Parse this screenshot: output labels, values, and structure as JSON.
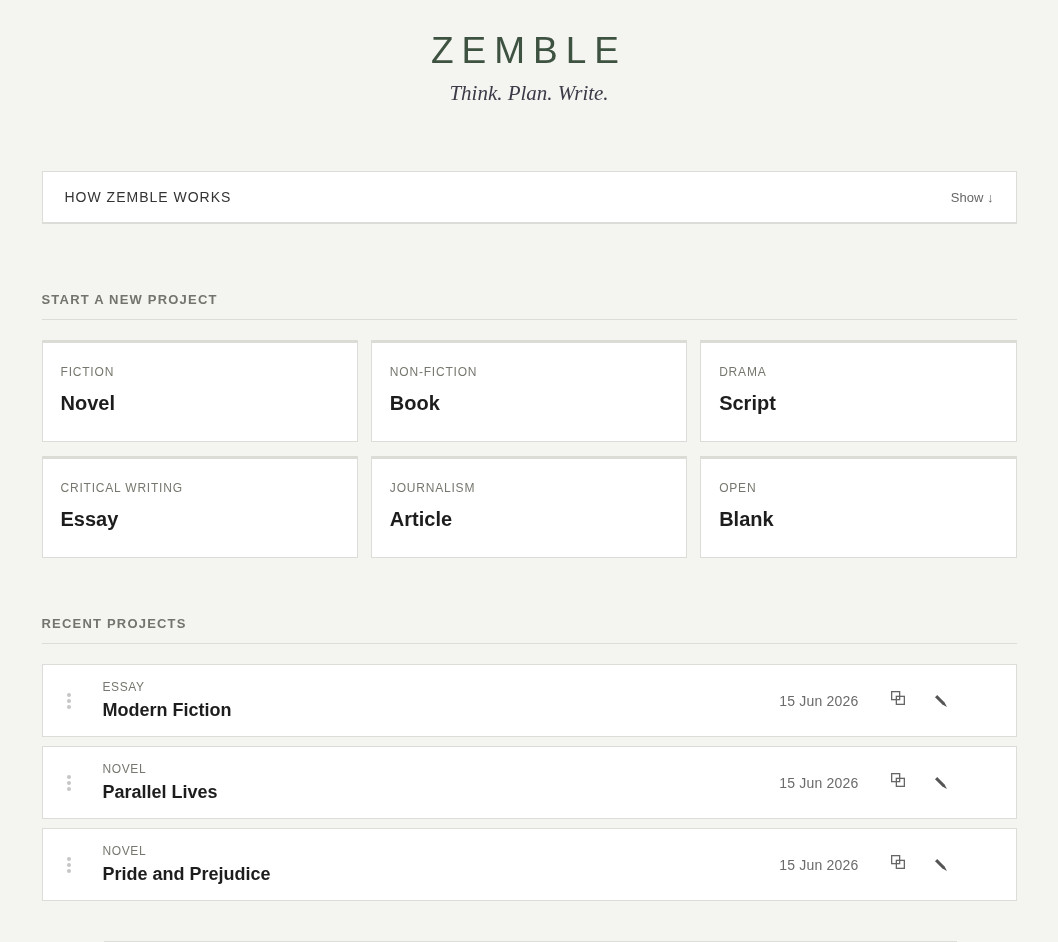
{
  "header": {
    "logo": "ZEMBLE",
    "tagline": "Think. Plan. Write."
  },
  "how_it_works": {
    "title": "HOW ZEMBLE WORKS",
    "toggle": "Show ↓"
  },
  "new_project": {
    "heading": "START A NEW PROJECT",
    "templates": [
      {
        "category": "FICTION",
        "name": "Novel"
      },
      {
        "category": "NON-FICTION",
        "name": "Book"
      },
      {
        "category": "DRAMA",
        "name": "Script"
      },
      {
        "category": "CRITICAL WRITING",
        "name": "Essay"
      },
      {
        "category": "JOURNALISM",
        "name": "Article"
      },
      {
        "category": "OPEN",
        "name": "Blank"
      }
    ]
  },
  "recent_projects": {
    "heading": "RECENT PROJECTS",
    "projects": [
      {
        "type": "ESSAY",
        "title": "Modern Fiction",
        "date": "15 Jun 2026"
      },
      {
        "type": "NOVEL",
        "title": "Parallel Lives",
        "date": "15 Jun 2026"
      },
      {
        "type": "NOVEL",
        "title": "Pride and Prejudice",
        "date": "15 Jun 2026"
      }
    ]
  }
}
